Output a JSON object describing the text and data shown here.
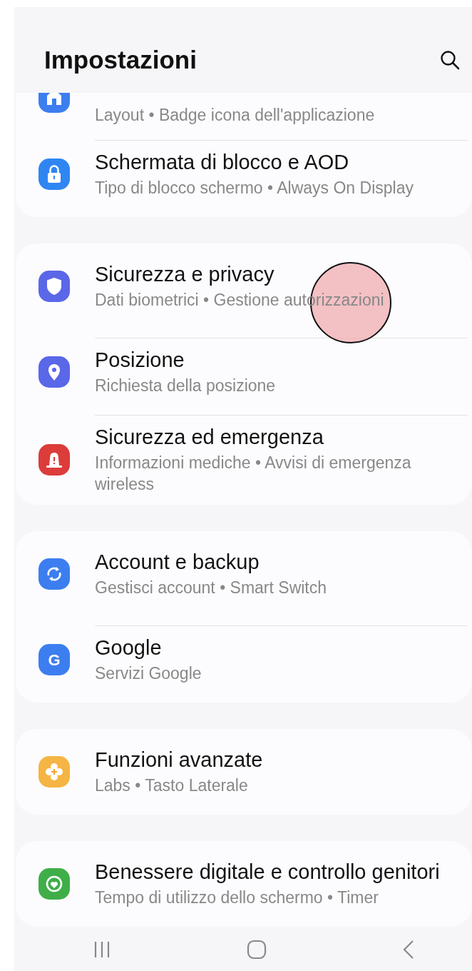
{
  "header": {
    "title": "Impostazioni"
  },
  "groups": [
    {
      "items": [
        {
          "kind": "home",
          "color": "#3c7ef0",
          "subtitle": "Layout • Badge icona dell'applicazione"
        },
        {
          "kind": "lock",
          "color": "#2f86f3",
          "title": "Schermata di blocco e AOD",
          "subtitle": "Tipo di blocco schermo • Always On Display"
        }
      ]
    },
    {
      "items": [
        {
          "kind": "shield",
          "color": "#5a67e8",
          "title": "Sicurezza e privacy",
          "subtitle": "Dati biometrici • Gestione autorizzazioni"
        },
        {
          "kind": "pin",
          "color": "#5a67e8",
          "title": "Posizione",
          "subtitle": "Richiesta della posizione"
        },
        {
          "kind": "alert",
          "color": "#dc3c3a",
          "title": "Sicurezza ed emergenza",
          "subtitle": "Informazioni mediche • Avvisi di emergenza wireless"
        }
      ]
    },
    {
      "items": [
        {
          "kind": "sync",
          "color": "#3c7ef0",
          "title": "Account e backup",
          "subtitle": "Gestisci account • Smart Switch"
        },
        {
          "kind": "letter",
          "glyph": "G",
          "color": "#3c7ef0",
          "title": "Google",
          "subtitle": "Servizi Google"
        }
      ]
    },
    {
      "items": [
        {
          "kind": "flower",
          "color": "#f5b544",
          "title": "Funzioni avanzate",
          "subtitle": "Labs • Tasto Laterale"
        }
      ]
    },
    {
      "items": [
        {
          "kind": "wellbeing",
          "color": "#3fae49",
          "title": "Benessere digitale e controllo genitori",
          "subtitle": "Tempo di utilizzo dello schermo • Timer"
        }
      ]
    }
  ],
  "touch_indicator": {
    "shown": true
  }
}
